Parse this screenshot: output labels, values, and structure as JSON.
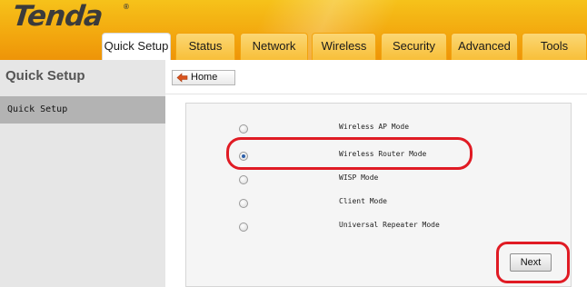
{
  "app": {
    "logo_text": "Tenda",
    "logo_mark": "®"
  },
  "nav": {
    "tabs": [
      {
        "label": "Quick Setup",
        "active": true
      },
      {
        "label": "Status",
        "active": false
      },
      {
        "label": "Network",
        "active": false
      },
      {
        "label": "Wireless",
        "active": false
      },
      {
        "label": "Security",
        "active": false
      },
      {
        "label": "Advanced",
        "active": false
      },
      {
        "label": "Tools",
        "active": false
      }
    ]
  },
  "sidebar": {
    "title": "Quick Setup",
    "items": [
      {
        "label": "Quick Setup",
        "selected": true
      }
    ]
  },
  "main": {
    "home_button": {
      "label": "Home",
      "icon": "arrow-left-icon"
    },
    "modes": [
      {
        "label": "Wireless AP Mode",
        "checked": false
      },
      {
        "label": "Wireless Router Mode",
        "checked": true
      },
      {
        "label": "WISP Mode",
        "checked": false
      },
      {
        "label": "Client Mode",
        "checked": false
      },
      {
        "label": "Universal Repeater Mode",
        "checked": false
      }
    ],
    "next_button": {
      "label": "Next"
    }
  },
  "colors": {
    "header_orange": "#f3a90f",
    "tab_yellow": "#f8bf39",
    "highlight_red": "#e01b24",
    "sidebar_gray": "#e6e6e6",
    "sidebar_selected": "#b3b3b3"
  }
}
